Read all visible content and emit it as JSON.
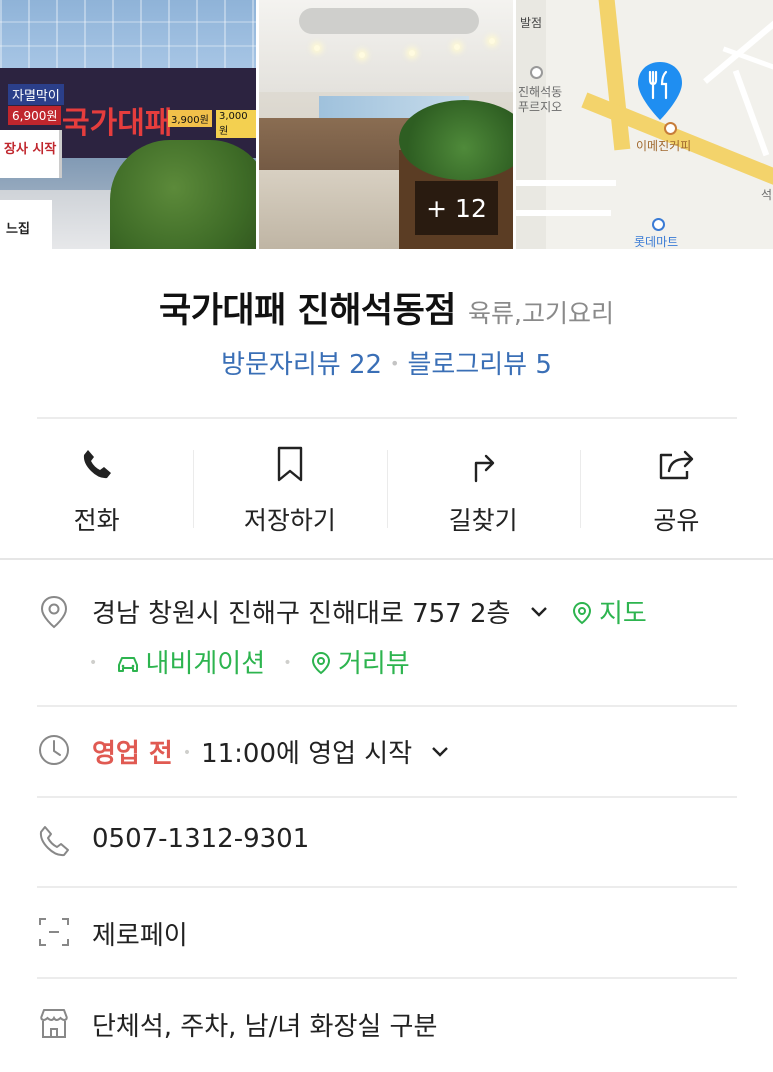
{
  "gallery": {
    "building_sign": {
      "brand": "국가대패",
      "promo1": "자멸막이",
      "promo2": "6,900원",
      "promo3": "3,900원",
      "promo4": "3,000원",
      "panel_top": "장사 시작",
      "panel_bottom": "느집"
    },
    "more_count": "+ 12",
    "map_labels": {
      "top": "발점",
      "left1": "진해석동",
      "left2": "푸르지오",
      "cafe": "이메진커피",
      "mart": "롯데마트",
      "right_edge": "석"
    }
  },
  "place": {
    "name": "국가대패 진해석동점",
    "category": "육류,고기요리",
    "visitor_reviews": "방문자리뷰 22",
    "blog_reviews": "블로그리뷰 5"
  },
  "actions": [
    {
      "label": "전화",
      "icon": "phone-icon"
    },
    {
      "label": "저장하기",
      "icon": "bookmark-icon"
    },
    {
      "label": "길찾기",
      "icon": "directions-icon"
    },
    {
      "label": "공유",
      "icon": "share-icon"
    }
  ],
  "info": {
    "address": "경남 창원시 진해구 진해대로 757 2층",
    "map_link": "지도",
    "navigation_link": "내비게이션",
    "street_view_link": "거리뷰",
    "status": "영업 전",
    "hours": "11:00에 영업 시작",
    "phone": "0507-1312-9301",
    "payment": "제로페이",
    "facilities": "단체석, 주차, 남/녀 화장실 구분"
  },
  "colors": {
    "accent_blue": "#3a6fb6",
    "link_green": "#2db44f",
    "status_red": "#e05a52",
    "map_pin_blue": "#1f8ef1"
  }
}
